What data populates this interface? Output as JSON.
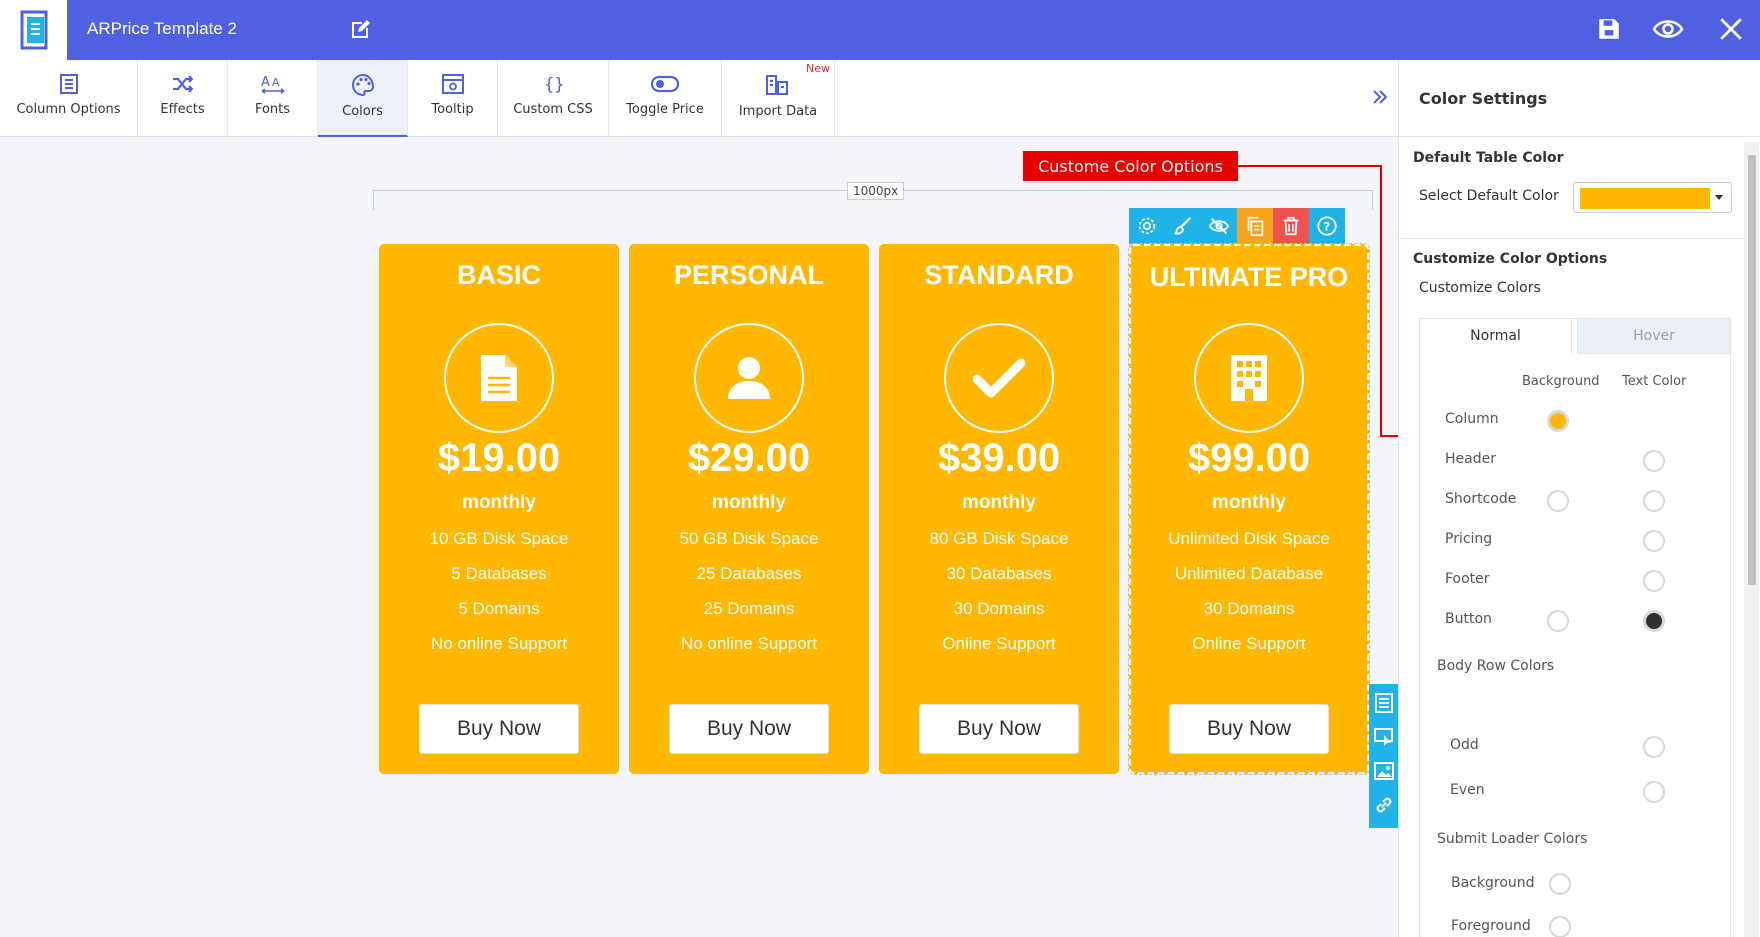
{
  "app": {
    "title": "ARPrice Template 2"
  },
  "toolbar": {
    "items": [
      {
        "label": "Column Options",
        "icon": "column-options-icon"
      },
      {
        "label": "Effects",
        "icon": "shuffle-icon"
      },
      {
        "label": "Fonts",
        "icon": "fonts-icon"
      },
      {
        "label": "Colors",
        "icon": "palette-icon",
        "active": true
      },
      {
        "label": "Tooltip",
        "icon": "tooltip-icon"
      },
      {
        "label": "Custom CSS",
        "icon": "braces-icon"
      },
      {
        "label": "Toggle Price",
        "icon": "toggle-icon"
      },
      {
        "label": "Import Data",
        "icon": "import-data-icon",
        "badge": "New"
      }
    ]
  },
  "canvas": {
    "ruler_label": "1000px",
    "callout": "Custome Color Options"
  },
  "cards": [
    {
      "title": "BASIC",
      "price": "$19.00",
      "period": "monthly",
      "features": [
        "10 GB Disk Space",
        "5 Databases",
        "5 Domains",
        "No online Support"
      ],
      "button": "Buy Now",
      "icon": "document-icon"
    },
    {
      "title": "PERSONAL",
      "price": "$29.00",
      "period": "monthly",
      "features": [
        "50 GB Disk Space",
        "25 Databases",
        "25 Domains",
        "No online Support"
      ],
      "button": "Buy Now",
      "icon": "user-icon"
    },
    {
      "title": "STANDARD",
      "price": "$39.00",
      "period": "monthly",
      "features": [
        "80 GB Disk Space",
        "30 Databases",
        "30 Domains",
        "Online Support"
      ],
      "button": "Buy Now",
      "icon": "checkmark-icon"
    },
    {
      "title": "ULTIMATE PRO",
      "price": "$99.00",
      "period": "monthly",
      "features": [
        "Unlimited Disk Space",
        "Unlimited Database",
        "30 Domains",
        "Online Support"
      ],
      "button": "Buy Now",
      "icon": "building-icon"
    }
  ],
  "panel": {
    "title": "Color Settings",
    "default_table_color": {
      "heading": "Default Table Color",
      "label": "Select Default Color",
      "value": "#ffb700"
    },
    "customize": {
      "heading": "Customize Color Options",
      "sub": "Customize Colors",
      "tabs": [
        "Normal",
        "Hover"
      ],
      "col_background": "Background",
      "col_text": "Text Color",
      "rows": [
        "Column",
        "Header",
        "Shortcode",
        "Pricing",
        "Footer",
        "Button"
      ],
      "body_row_heading": "Body Row Colors",
      "body_rows": [
        "Odd",
        "Even"
      ],
      "loader_heading": "Submit Loader Colors",
      "loader_rows": [
        "Background",
        "Foreground"
      ]
    }
  },
  "colors": {
    "brand": "#4f60e0",
    "card": "#ffb700",
    "accent_blue": "#1fb3e8",
    "callout_red": "#e60000"
  }
}
